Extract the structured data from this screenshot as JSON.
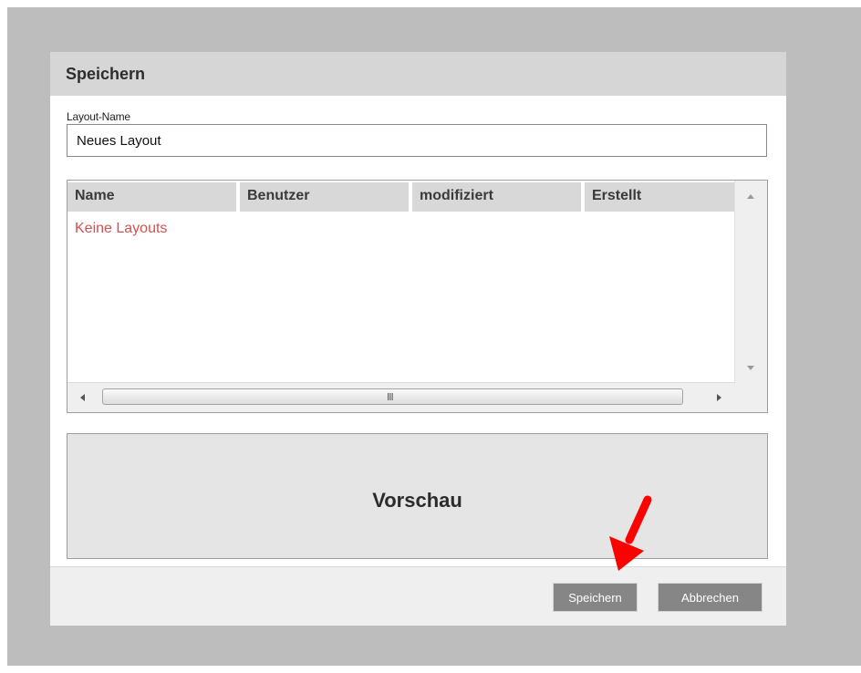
{
  "dialog": {
    "title": "Speichern",
    "layout_name_label": "Layout-Name",
    "layout_name_value": "Neues Layout"
  },
  "table": {
    "columns": [
      "Name",
      "Benutzer",
      "modifiziert",
      "Erstellt"
    ],
    "empty_message": "Keine Layouts",
    "scrollbar_grip": "III"
  },
  "preview": {
    "label": "Vorschau"
  },
  "footer": {
    "save_label": "Speichern",
    "cancel_label": "Abbrechen"
  },
  "annotation": {
    "icon": "red-arrow-icon",
    "color": "#ff0000"
  },
  "colors": {
    "backdrop": "#bdbdbd",
    "header": "#d6d6d6",
    "button": "#868686",
    "empty_message": "#d0524f"
  }
}
